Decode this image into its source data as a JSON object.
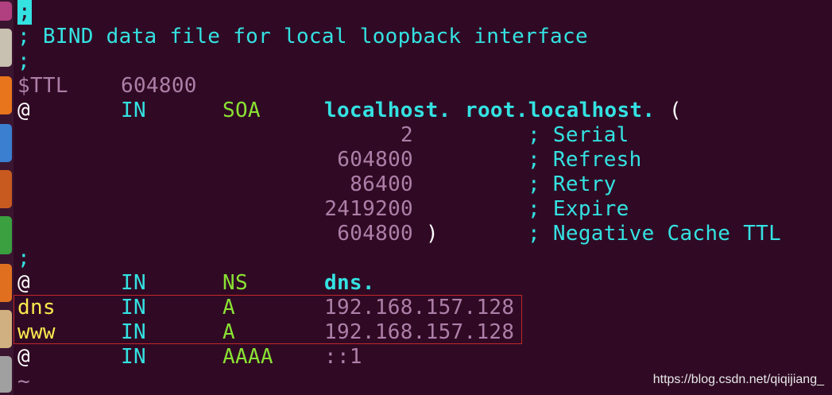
{
  "editor": {
    "lines": [
      {
        "comment": ";"
      },
      {
        "comment": "; BIND data file for local loopback interface"
      },
      {
        "comment": ";"
      },
      {
        "directive": "$TTL",
        "value": "604800"
      },
      {
        "name": "@",
        "class": "IN",
        "type": "SOA",
        "primary": "localhost.",
        "admin": "root.localhost.",
        "paren": "("
      },
      {
        "number": "2",
        "comment": "; Serial"
      },
      {
        "number": "604800",
        "comment": "; Refresh"
      },
      {
        "number": "86400",
        "comment": "; Retry"
      },
      {
        "number": "2419200",
        "comment": "; Expire"
      },
      {
        "number": "604800",
        "paren": ")",
        "comment": "; Negative Cache TTL"
      },
      {
        "comment": ";"
      },
      {
        "name": "@",
        "class": "IN",
        "type": "NS",
        "value": "dns."
      },
      {
        "name": "dns",
        "class": "IN",
        "type": "A",
        "value": "192.168.157.128"
      },
      {
        "name": "www",
        "class": "IN",
        "type": "A",
        "value": "192.168.157.128"
      },
      {
        "name": "@",
        "class": "IN",
        "type": "AAAA",
        "value": "::1"
      }
    ],
    "tilde": "~"
  },
  "watermark": "https://blog.csdn.net/qiqijiang_",
  "colors": {
    "background": "#300a24",
    "comment": "#34e2e2",
    "number": "#ad7fa8",
    "keyword": "#8ae234",
    "name": "#fce94f",
    "highlight_border": "#c0282a"
  }
}
